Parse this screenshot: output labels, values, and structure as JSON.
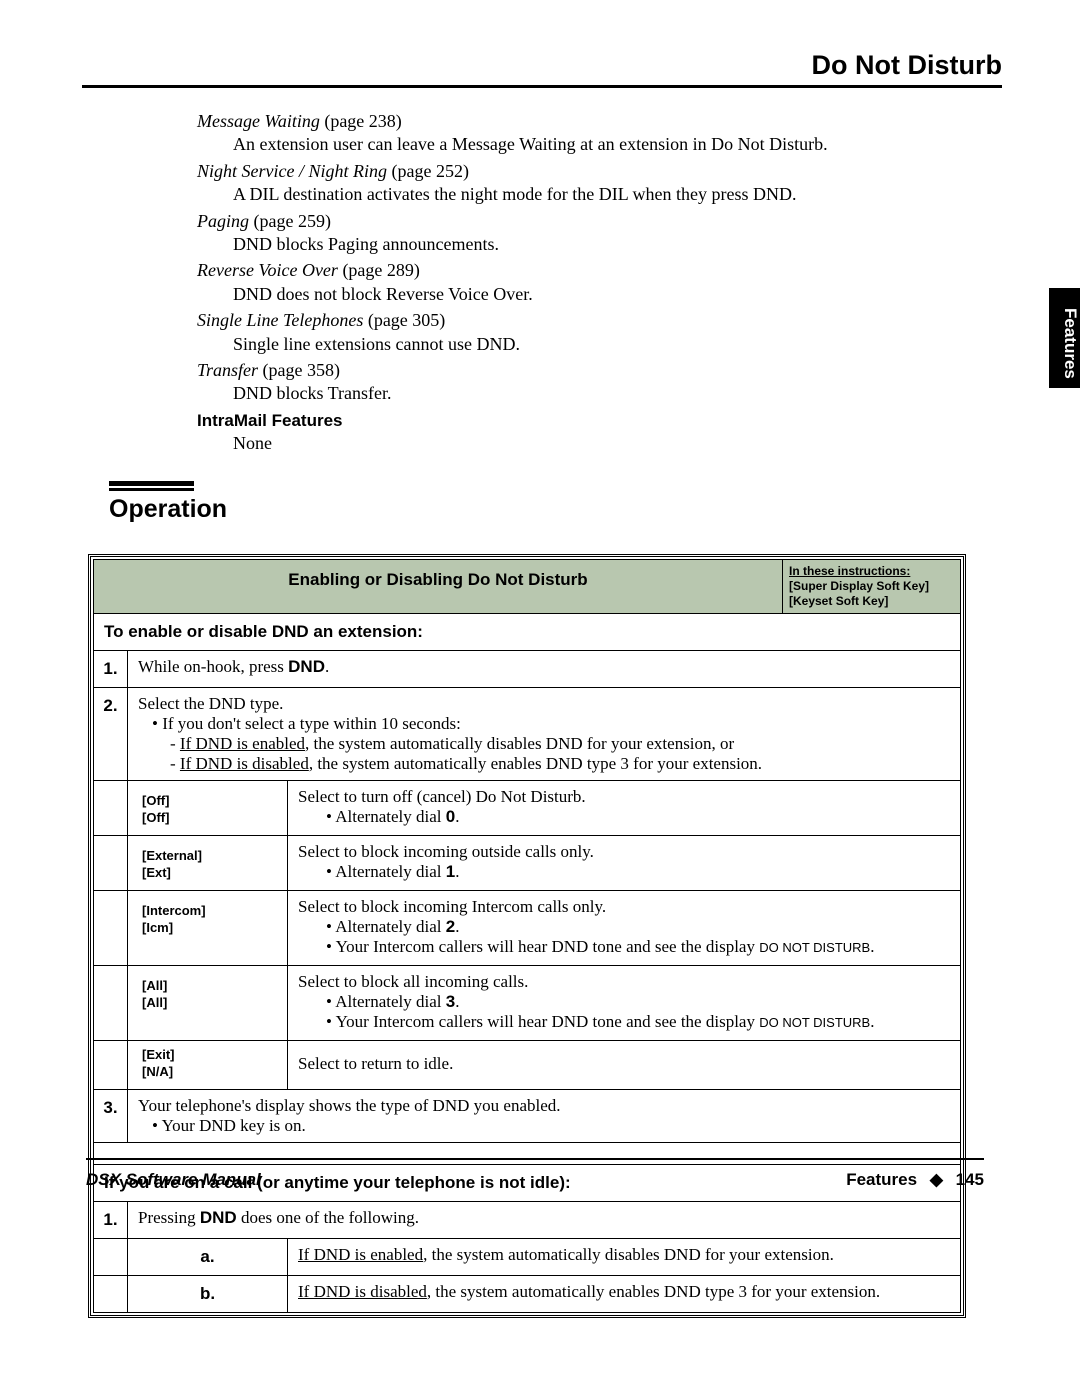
{
  "header": {
    "title": "Do Not Disturb"
  },
  "sideTab": "Features",
  "refs": [
    {
      "title": "Message Waiting",
      "page": "(page 238)",
      "desc": "An extension user can leave a Message Waiting at an extension in Do Not Disturb."
    },
    {
      "title": "Night Service / Night Ring",
      "page": "(page 252)",
      "desc": "A DIL destination activates the night mode for the DIL when they press DND."
    },
    {
      "title": "Paging",
      "page": "(page 259)",
      "desc": "DND blocks Paging announcements."
    },
    {
      "title": "Reverse Voice Over",
      "page": "(page 289)",
      "desc": "DND does not block Reverse Voice Over."
    },
    {
      "title": "Single Line Telephones",
      "page": "(page 305)",
      "desc": "Single line extensions cannot use DND."
    },
    {
      "title": "Transfer",
      "page": "(page 358)",
      "desc": "DND blocks Transfer."
    }
  ],
  "intramail": {
    "heading": "IntraMail Features",
    "value": "None"
  },
  "operation": {
    "heading": "Operation"
  },
  "table": {
    "title": "Enabling or Disabling Do Not Disturb",
    "legend": {
      "line1": "In these instructions:",
      "line2": "[Super Display Soft Key]",
      "line3": "[Keyset Soft Key]"
    },
    "section1": "To enable or disable DND an extension:",
    "step1": {
      "num": "1.",
      "pre": "While on-hook, press ",
      "key": "DND",
      "post": "."
    },
    "step2": {
      "num": "2.",
      "line1": "Select the DND type.",
      "bullet": "If you don't select a type within 10 seconds:",
      "dash1a": "If DND is enabled",
      "dash1b": ", the system automatically disables DND for your extension, or",
      "dash2a": "If DND is disabled",
      "dash2b": ", the system automatically enables DND type 3 for your extension."
    },
    "opts": [
      {
        "k1": "[Off]",
        "k2": "[Off]",
        "d1": "Select to turn off (cancel) Do Not Disturb.",
        "b1pre": "Alternately dial ",
        "b1key": "0",
        "b1post": ".",
        "rest": []
      },
      {
        "k1": "[External]",
        "k2": "[Ext]",
        "d1": "Select to block incoming outside calls only.",
        "b1pre": "Alternately dial ",
        "b1key": "1",
        "b1post": ".",
        "rest": []
      },
      {
        "k1": "[Intercom]",
        "k2": "[Icm]",
        "d1": "Select to block incoming Intercom calls only.",
        "b1pre": "Alternately dial ",
        "b1key": "2",
        "b1post": ".",
        "rest": [
          {
            "pre": "Your Intercom callers will hear DND tone and see the display ",
            "caps": "DO NOT DISTURB",
            "post": "."
          }
        ]
      },
      {
        "k1": "[All]",
        "k2": "[All]",
        "d1": "Select to block all incoming calls.",
        "b1pre": "Alternately dial ",
        "b1key": "3",
        "b1post": ".",
        "rest": [
          {
            "pre": "Your Intercom callers will hear DND tone and see the display ",
            "caps": "DO NOT DISTURB",
            "post": "."
          }
        ]
      },
      {
        "k1": "[Exit]",
        "k2": "[N/A]",
        "d1": "Select to return to idle.",
        "noBullets": true
      }
    ],
    "step3": {
      "num": "3.",
      "line1": "Your telephone's display shows the type of DND you enabled.",
      "bullet": "Your DND key is on."
    },
    "section2": "If you are on a call (or anytime your telephone is not idle):",
    "stepB1": {
      "num": "1.",
      "pre": "Pressing ",
      "key": "DND",
      "post": " does one of the following."
    },
    "subA": {
      "letter": "a.",
      "u": "If DND is enabled",
      "rest": ", the system automatically disables DND for your extension."
    },
    "subB": {
      "letter": "b.",
      "u": "If DND is disabled",
      "rest": ", the system automatically enables DND type 3 for your extension."
    }
  },
  "footer": {
    "left": "DSX Software Manual",
    "rightLabel": "Features",
    "diamond": "◆",
    "page": "145"
  }
}
